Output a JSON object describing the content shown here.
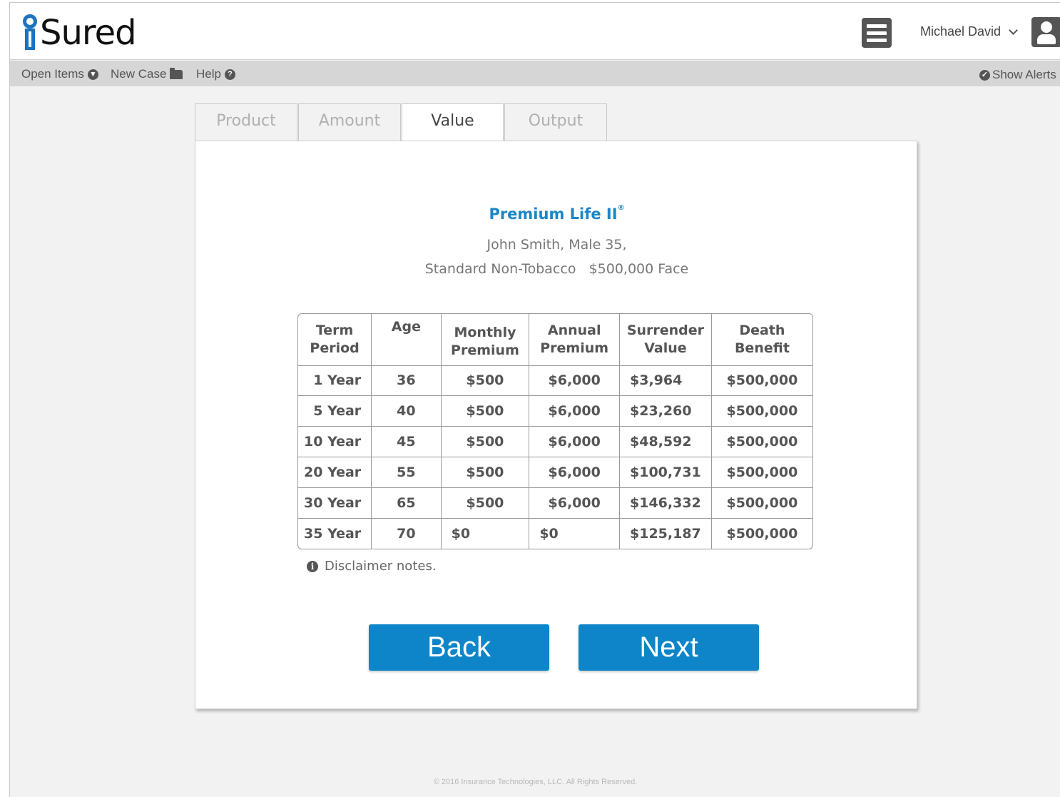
{
  "app": {
    "logo_text": "Sured",
    "logo_mark": "i-mark-icon"
  },
  "header": {
    "user_name": "Michael David"
  },
  "toolbar": {
    "open_items": "Open Items",
    "new_case": "New Case",
    "help": "Help",
    "show_alerts": "Show Alerts"
  },
  "tabs": [
    {
      "label": "Product",
      "active": false
    },
    {
      "label": "Amount",
      "active": false
    },
    {
      "label": "Value",
      "active": true
    },
    {
      "label": "Output",
      "active": false
    }
  ],
  "product": {
    "title": "Premium Life II",
    "mark": "®",
    "client_line1": "John Smith, Male 35,",
    "client_line2": "Standard Non-Tobacco   $500,000 Face"
  },
  "table": {
    "headers": [
      [
        "Term",
        "Period"
      ],
      [
        "Age",
        ""
      ],
      [
        "Monthly",
        "Premium"
      ],
      [
        "Annual",
        "Premium"
      ],
      [
        "Surrender",
        "Value"
      ],
      [
        "Death",
        "Benefit"
      ]
    ],
    "rows": [
      [
        "1 Year",
        "36",
        "$500",
        "$6,000",
        "$3,964",
        "$500,000"
      ],
      [
        "5 Year",
        "40",
        "$500",
        "$6,000",
        "$23,260",
        "$500,000"
      ],
      [
        "10 Year",
        "45",
        "$500",
        "$6,000",
        "$48,592",
        "$500,000"
      ],
      [
        "20 Year",
        "55",
        "$500",
        "$6,000",
        "$100,731",
        "$500,000"
      ],
      [
        "30 Year",
        "65",
        "$500",
        "$6,000",
        "$146,332",
        "$500,000"
      ],
      [
        "35 Year",
        "70",
        "$0",
        "$0",
        "$125,187",
        "$500,000"
      ]
    ]
  },
  "disclaimer": "Disclaimer notes.",
  "buttons": {
    "back": "Back",
    "next": "Next"
  },
  "footer": "© 2016 Insurance Technologies, LLC. All Rights Reserved.",
  "colors": {
    "brand": "#1e73be",
    "button": "#0e85c8",
    "title": "#1a86c8"
  }
}
